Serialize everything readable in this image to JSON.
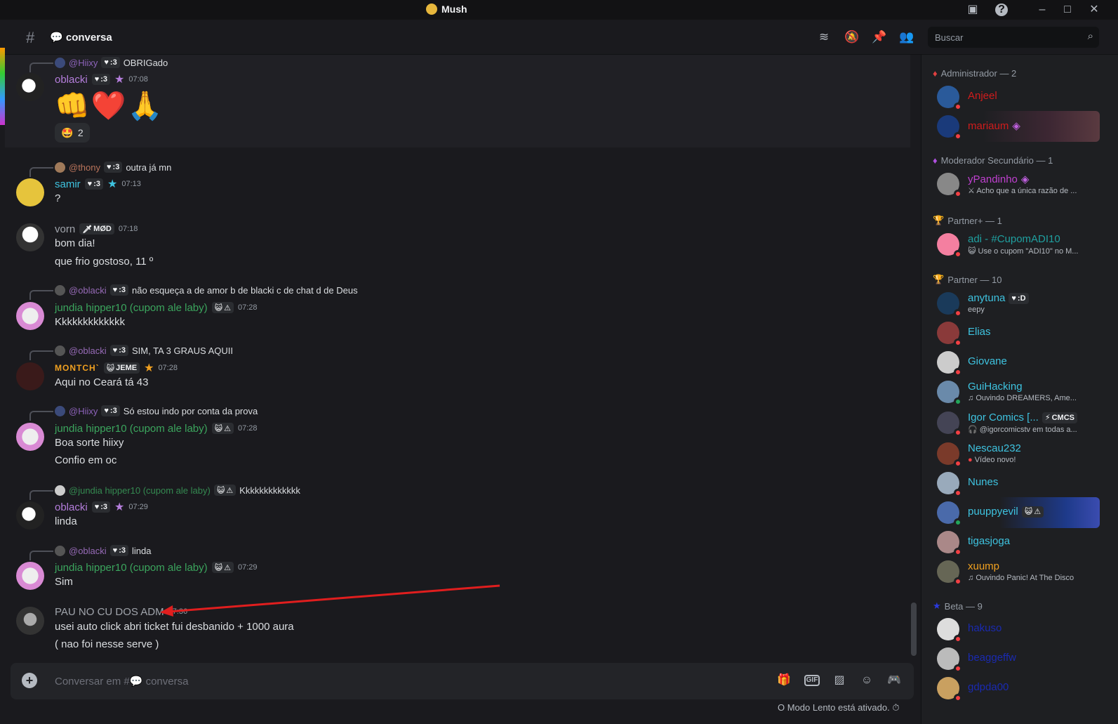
{
  "window": {
    "title": "Mush"
  },
  "header": {
    "channel_name": "conversa",
    "search_placeholder": "Buscar"
  },
  "messages": [
    {
      "reply": {
        "name": "@Hiixy",
        "tag": ":3",
        "text": "OBRIGado"
      },
      "user": "oblacki",
      "tag": ":3",
      "time": "07:08",
      "emoji": "👊❤️🙏",
      "reaction": {
        "emoji": "🤩",
        "count": "2"
      }
    },
    {
      "reply": {
        "name": "@thony",
        "tag": ":3",
        "text": "outra já mn"
      },
      "user": "samir",
      "tag": ":3",
      "time": "07:13",
      "lines": [
        "?"
      ]
    },
    {
      "user": "vorn",
      "tag": "MØD",
      "time": "07:18",
      "lines": [
        "bom dia!",
        "que frio gostoso, 11 º"
      ]
    },
    {
      "reply": {
        "name": "@oblacki",
        "tag": ":3",
        "text": "não esqueça  a de amor b de blacki  c de chat d de Deus"
      },
      "user": "jundia hipper10 (cupom ale laby)",
      "tag": "⚠",
      "time": "07:28",
      "lines": [
        "Kkkkkkkkkkkkk"
      ]
    },
    {
      "reply": {
        "name": "@oblacki",
        "tag": ":3",
        "text": "SIM, TA 3 GRAUS AQUII"
      },
      "user": "MONTCH`",
      "tag": "JEME",
      "time": "07:28",
      "lines": [
        "Aqui no Ceará tá 43"
      ]
    },
    {
      "reply": {
        "name": "@Hiixy",
        "tag": ":3",
        "text": "Só estou indo por conta da prova"
      },
      "user": "jundia hipper10 (cupom ale laby)",
      "tag": "⚠",
      "time": "07:28",
      "lines": [
        "Boa sorte hiixy",
        "Confio em oc"
      ]
    },
    {
      "reply": {
        "name": "@jundia hipper10 (cupom ale laby)",
        "tag": "⚠",
        "text": "Kkkkkkkkkkkkk"
      },
      "user": "oblacki",
      "tag": ":3",
      "time": "07:29",
      "lines": [
        "linda"
      ]
    },
    {
      "reply": {
        "name": "@oblacki",
        "tag": ":3",
        "text": "linda"
      },
      "user": "jundia hipper10 (cupom ale laby)",
      "tag": "⚠",
      "time": "07:29",
      "lines": [
        "Sim"
      ]
    },
    {
      "user": "PAU NO CU DOS ADM",
      "time": "07:36",
      "lines": [
        "usei auto click abri ticket fui desbanido + 1000 aura",
        "( nao foi nesse serve )"
      ]
    }
  ],
  "composer": {
    "placeholder_prefix": "Conversar em #",
    "placeholder_channel": "conversa",
    "gif_label": "GIF",
    "slowmode": "O Modo Lento está ativado."
  },
  "members": {
    "groups": [
      {
        "label": "Administrador — 2"
      },
      {
        "label": "Moderador Secundário — 1"
      },
      {
        "label": "Partner+ — 1"
      },
      {
        "label": "Partner — 10"
      },
      {
        "label": "Beta — 9"
      }
    ],
    "items": [
      {
        "name": "Anjeel",
        "activity": ""
      },
      {
        "name": "mariaum",
        "activity": ""
      },
      {
        "name": "yPandinho",
        "activity": "Acho que a única razão de ..."
      },
      {
        "name": "adi - #CupomADI10",
        "activity": "Use o cupom \"ADI10\" no M..."
      },
      {
        "name": "anytuna",
        "tag": ":D",
        "activity": "eepy"
      },
      {
        "name": "Elias",
        "activity": ""
      },
      {
        "name": "Giovane",
        "activity": ""
      },
      {
        "name": "GuiHacking",
        "activity": "Ouvindo DREAMERS, Ame..."
      },
      {
        "name": "Igor Comics [...",
        "tag": "CMCS",
        "activity": "@igorcomicstv em todas a..."
      },
      {
        "name": "Nescau232",
        "activity": "Vídeo novo!"
      },
      {
        "name": "Nunes",
        "activity": ""
      },
      {
        "name": "puuppyevil",
        "tag": "⚠",
        "activity": ""
      },
      {
        "name": "tigasjoga",
        "activity": ""
      },
      {
        "name": "xuump",
        "activity": "Ouvindo Panic! At The Disco"
      },
      {
        "name": "hakuso",
        "activity": ""
      },
      {
        "name": "beaggeffw",
        "activity": ""
      },
      {
        "name": "gdpda00",
        "activity": ""
      }
    ]
  },
  "colors": {
    "accent_red": "#f23f43",
    "online": "#23a55a",
    "annotation_arrow": "#e01e1e"
  }
}
